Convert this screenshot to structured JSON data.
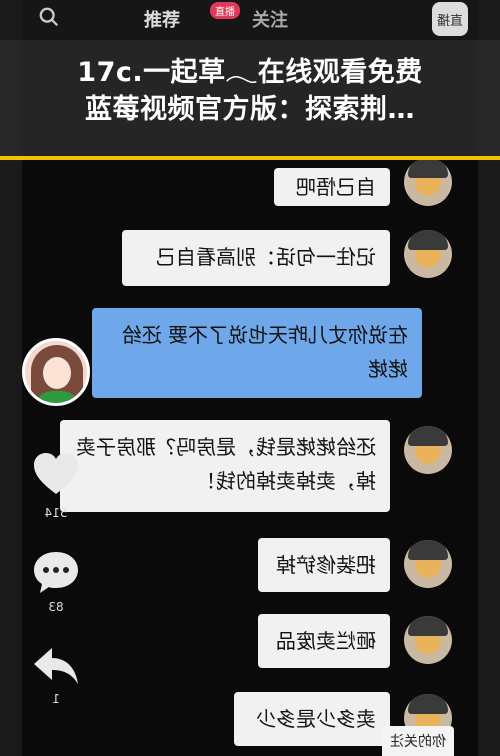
{
  "banner": {
    "line1": "17c.一起草𓂃在线观看免费",
    "line2": "蓝莓视频官方版：探索荆…"
  },
  "appbar": {
    "tab_recommend": "推荐",
    "tab_follow": "关注",
    "live_badge": "直播",
    "top_right_label": "直播"
  },
  "chat": {
    "messages": [
      {
        "text": "自己悟吧",
        "style": "gray"
      },
      {
        "text": "记住一句话：别高看自己",
        "style": "gray"
      },
      {
        "text": "在说你丈儿昨天也说了不要 还给姥姥",
        "style": "blue"
      },
      {
        "text": "还给姥姥是钱，是房吗？那房子卖掉，卖掉卖掉的钱！",
        "style": "gray"
      },
      {
        "text": "把装修铲掉",
        "style": "gray"
      },
      {
        "text": "砸烂卖废品",
        "style": "gray"
      },
      {
        "text": "卖多少是多少",
        "style": "gray"
      }
    ]
  },
  "side": {
    "like_count": "514",
    "comment_count": "83",
    "share_count": "1"
  },
  "footer": {
    "follow_label": "你的关注"
  },
  "colors": {
    "banner_accent": "#f2c200",
    "blue_bubble": "#6fa8ea",
    "gray_bubble": "#f1f1f1"
  }
}
